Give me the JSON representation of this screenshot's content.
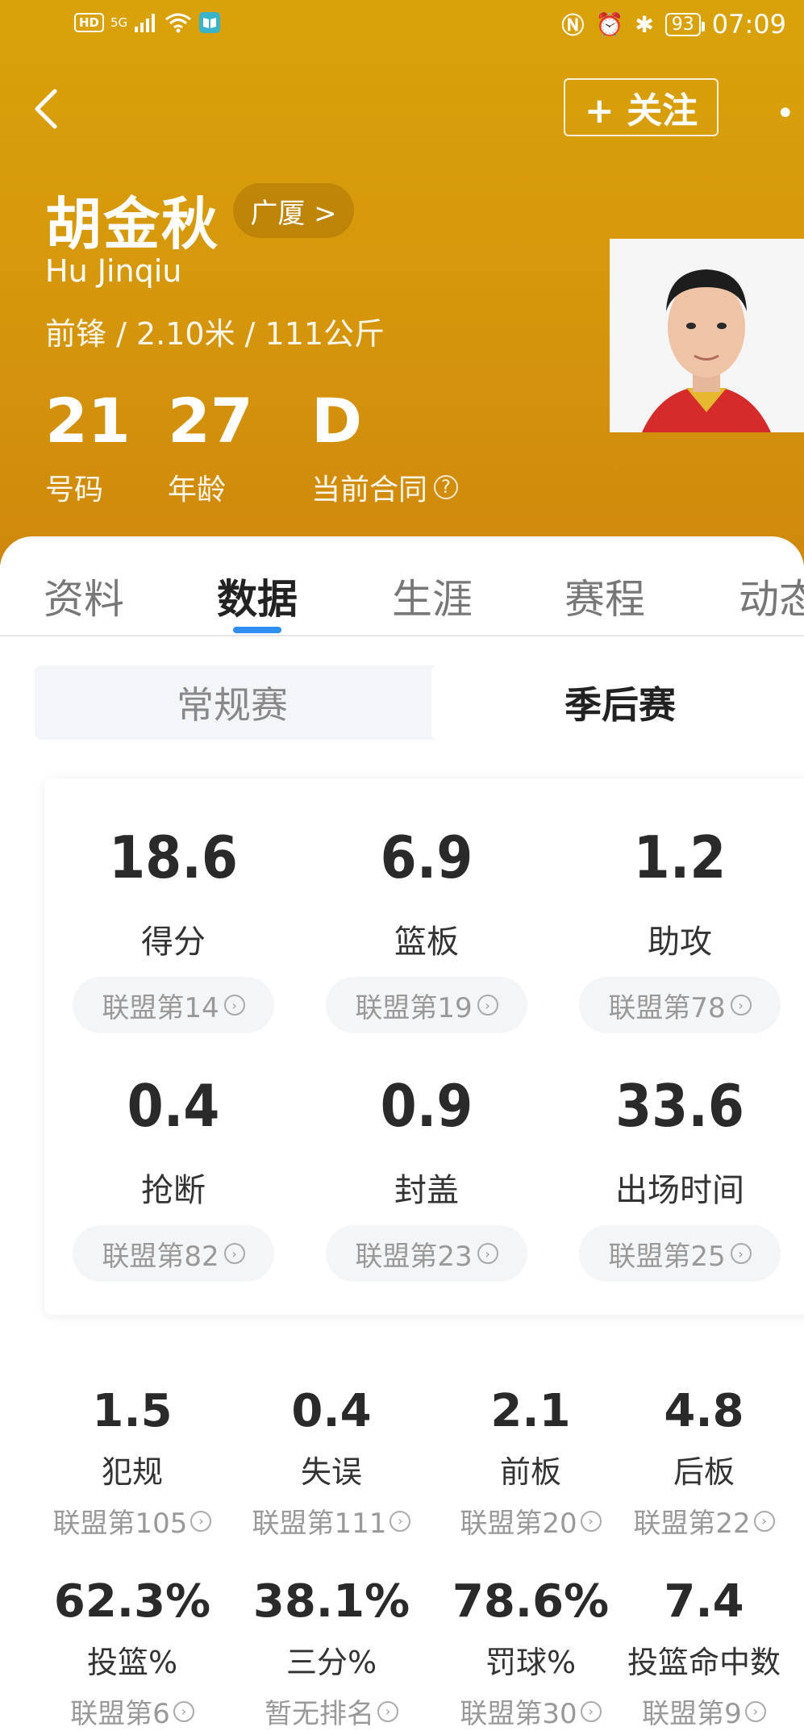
{
  "status_bar": {
    "left_badge": "HD",
    "network": "5G",
    "battery": "93",
    "time": "07:09"
  },
  "header": {
    "follow_label": "+ 关注",
    "name_cn": "胡金秋",
    "team": "广厦 >",
    "name_en": "Hu Jinqiu",
    "info": "前锋 / 2.10米 / 111公斤",
    "stats": [
      {
        "value": "21",
        "label": "号码"
      },
      {
        "value": "27",
        "label": "年龄"
      },
      {
        "value": "D",
        "label": "当前合同"
      }
    ]
  },
  "tabs": [
    "资料",
    "数据",
    "生涯",
    "赛程",
    "动态"
  ],
  "active_tab": "数据",
  "season_toggle": {
    "regular": "常规赛",
    "playoffs": "季后赛"
  },
  "main_stats": [
    {
      "value": "18.6",
      "label": "得分",
      "rank": "联盟第14"
    },
    {
      "value": "6.9",
      "label": "篮板",
      "rank": "联盟第19"
    },
    {
      "value": "1.2",
      "label": "助攻",
      "rank": "联盟第78"
    },
    {
      "value": "0.4",
      "label": "抢断",
      "rank": "联盟第82"
    },
    {
      "value": "0.9",
      "label": "封盖",
      "rank": "联盟第23"
    },
    {
      "value": "33.6",
      "label": "出场时间",
      "rank": "联盟第25"
    }
  ],
  "secondary_stats": [
    {
      "value": "1.5",
      "label": "犯规",
      "rank": "联盟第105"
    },
    {
      "value": "0.4",
      "label": "失误",
      "rank": "联盟第111"
    },
    {
      "value": "2.1",
      "label": "前板",
      "rank": "联盟第20"
    },
    {
      "value": "4.8",
      "label": "后板",
      "rank": "联盟第22"
    },
    {
      "value": "62.3%",
      "label": "投篮%",
      "rank": "联盟第6"
    },
    {
      "value": "38.1%",
      "label": "三分%",
      "rank": "暂无排名"
    },
    {
      "value": "78.6%",
      "label": "罚球%",
      "rank": "联盟第30"
    },
    {
      "value": "7.4",
      "label": "投篮命中数",
      "rank": "联盟第9"
    }
  ],
  "colors": {
    "header_bg": "#d69a0c",
    "accent": "#2f8ef0"
  }
}
